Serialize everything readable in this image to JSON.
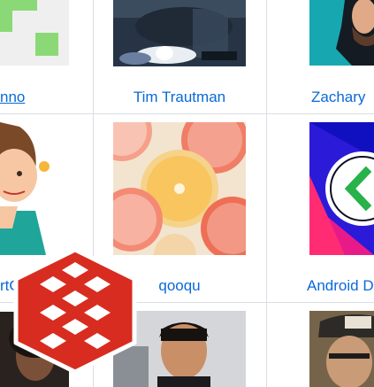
{
  "contributors": [
    {
      "name": "nno",
      "row": 1,
      "col": 0
    },
    {
      "name": "Tim Trautman",
      "row": 1,
      "col": 1
    },
    {
      "name": "Zachary",
      "row": 1,
      "col": 2
    },
    {
      "name": "rtOr",
      "row": 2,
      "col": 0
    },
    {
      "name": "qooqu",
      "row": 2,
      "col": 1
    },
    {
      "name": "Android D",
      "row": 2,
      "col": 2
    }
  ],
  "overlay": {
    "logo": "redis-logo"
  },
  "colors": {
    "link": "#0969da",
    "divider": "#d9dee3",
    "redis": "#d82c20"
  }
}
